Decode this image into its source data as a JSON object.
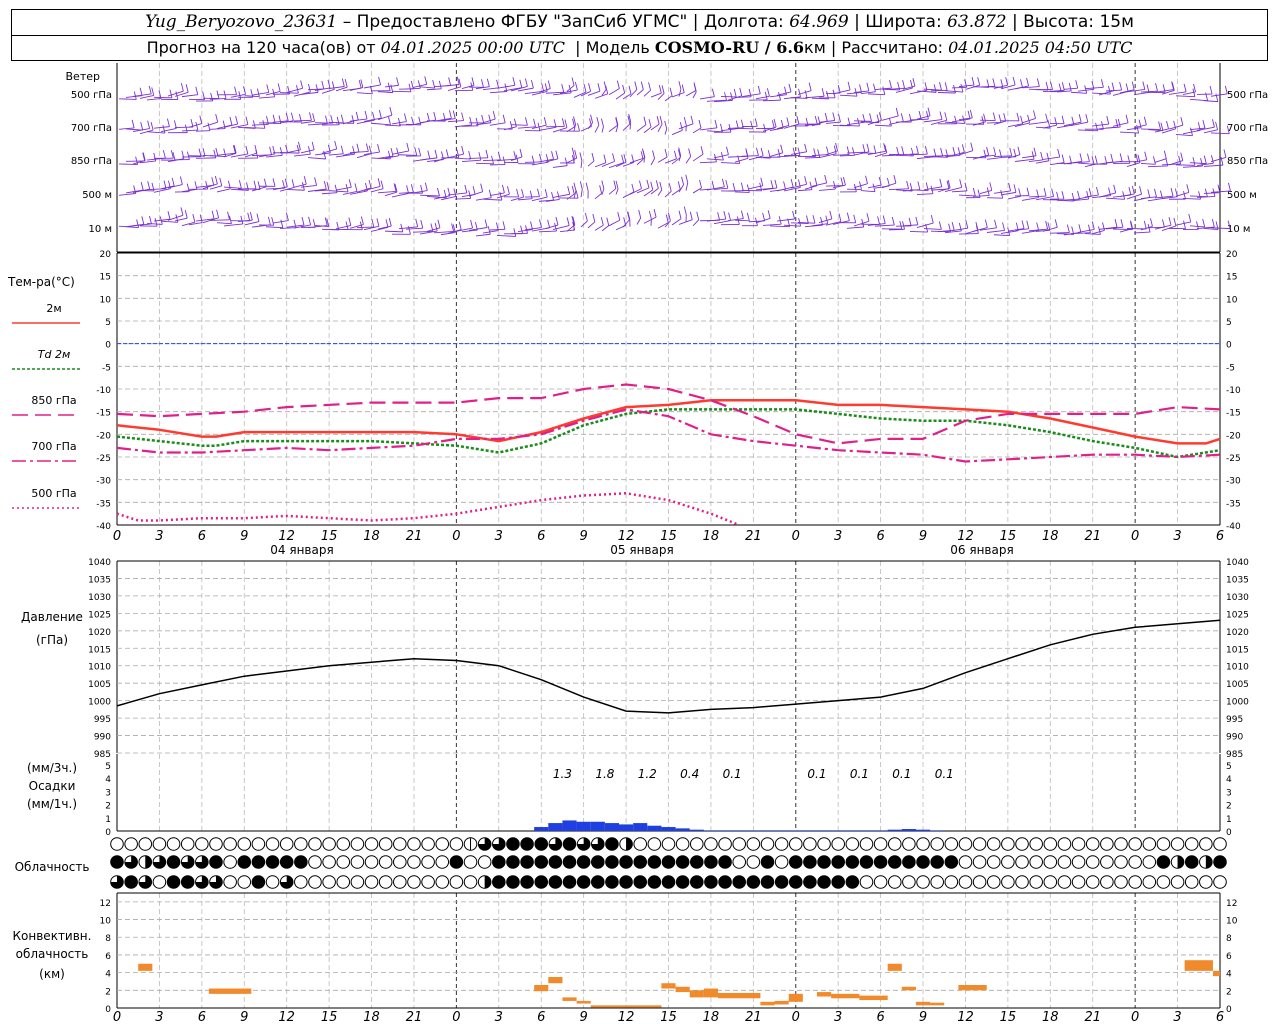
{
  "header": {
    "station": "Yug_Beryozovo_23631",
    "provided_label": "– Предоставлено ФГБУ \"ЗапСиб УГМС\"",
    "lon_label": "Долгота:",
    "lon": "64.969",
    "lat_label": "Широта:",
    "lat": "63.872",
    "alt_label": "Высота:",
    "alt": "15м",
    "forecast_label": "Прогноз на 120 часа(ов) от",
    "forecast_time": "04.01.2025 00:00 UTC",
    "model_label": "Модель",
    "model": "COSMO-RU / 6.6",
    "model_unit": "км",
    "calc_label": "Рассчитано:",
    "calc_time": "04.01.2025 04:50 UTC"
  },
  "chart_data": [
    {
      "type": "barbs",
      "ylabel": "Ветер",
      "levels": [
        "500 гПа",
        "700 гПа",
        "850 гПа",
        "500 м",
        "10 м"
      ],
      "barb_color": "#7b2fd0"
    },
    {
      "type": "line",
      "ylabel": "Тем-ра(°C)",
      "ylim": [
        -40,
        20
      ],
      "yticks": [
        -40,
        -35,
        -30,
        -25,
        -20,
        -15,
        -10,
        -5,
        0,
        5,
        10,
        15,
        20
      ],
      "x_hours": [
        0,
        3,
        6,
        9,
        12,
        15,
        18,
        21,
        24,
        27,
        30,
        33,
        36,
        39,
        42,
        45,
        48,
        51,
        54,
        57,
        60,
        63,
        66,
        69,
        72,
        75,
        78
      ],
      "xtick_labels": [
        "0",
        "3",
        "6",
        "9",
        "12",
        "15",
        "18",
        "21",
        "0",
        "3",
        "6",
        "9",
        "12",
        "15",
        "18",
        "21",
        "0",
        "3",
        "6",
        "9",
        "12",
        "15",
        "18",
        "21",
        "0",
        "3",
        "6"
      ],
      "date_labels": [
        "04 января",
        "05 января",
        "06 января"
      ],
      "zero_line": true,
      "series": [
        {
          "name": "2м",
          "color": "#ff3b30",
          "dash": "solid",
          "width": 2.5,
          "x": [
            0,
            3,
            6,
            7,
            9,
            12,
            18,
            21,
            24,
            27,
            30,
            33,
            36,
            39,
            42,
            45,
            48,
            51,
            54,
            57,
            60,
            63,
            66,
            69,
            72,
            75,
            77,
            78
          ],
          "y": [
            -18,
            -19,
            -20.5,
            -20.5,
            -19.5,
            -19.5,
            -19.5,
            -19.5,
            -20,
            -21.5,
            -19.5,
            -16.5,
            -14,
            -13.5,
            -12.5,
            -12.5,
            -12.5,
            -13.5,
            -13.5,
            -14,
            -14.5,
            -15,
            -16.5,
            -18.5,
            -20.5,
            -22,
            -22,
            -21
          ]
        },
        {
          "name": "Td 2м",
          "color": "#1a8c1a",
          "dash": "3,2",
          "width": 2.5,
          "x": [
            0,
            3,
            6,
            7,
            9,
            12,
            18,
            21,
            24,
            27,
            30,
            33,
            36,
            39,
            42,
            45,
            48,
            51,
            54,
            57,
            60,
            63,
            66,
            69,
            72,
            75,
            78
          ],
          "y": [
            -20.5,
            -21.5,
            -22.5,
            -22.5,
            -21.5,
            -21.5,
            -21.5,
            -22,
            -22.5,
            -24,
            -22,
            -18,
            -15.5,
            -14.5,
            -14.5,
            -14.5,
            -14.5,
            -15.5,
            -16.5,
            -17,
            -17,
            -18,
            -19.5,
            -21.5,
            -23,
            -25,
            -23.5
          ]
        },
        {
          "name": "850 гПа",
          "color": "#e0208a",
          "dash": "16,7",
          "width": 2.2,
          "x": [
            0,
            3,
            6,
            9,
            12,
            15,
            18,
            21,
            24,
            27,
            30,
            33,
            36,
            39,
            42,
            45,
            48,
            51,
            54,
            57,
            60,
            63,
            66,
            69,
            72,
            75,
            78
          ],
          "y": [
            -15.5,
            -16,
            -15.5,
            -15,
            -14,
            -13.5,
            -13,
            -13,
            -13,
            -12,
            -12,
            -10,
            -9,
            -10,
            -12.5,
            -16,
            -20,
            -22,
            -21,
            -21,
            -17,
            -15.5,
            -15.5,
            -15.5,
            -15.5,
            -14,
            -14.5
          ]
        },
        {
          "name": "700 гПа",
          "color": "#e0208a",
          "dash": "14,4,3,4",
          "width": 2.2,
          "x": [
            0,
            3,
            6,
            9,
            12,
            15,
            18,
            21,
            24,
            27,
            30,
            33,
            36,
            39,
            42,
            45,
            48,
            51,
            54,
            57,
            60,
            63,
            66,
            69,
            72,
            75,
            78
          ],
          "y": [
            -23,
            -24,
            -24,
            -23.5,
            -23,
            -23.5,
            -23,
            -22.5,
            -21,
            -21,
            -20,
            -17,
            -14.5,
            -16,
            -20,
            -21.5,
            -22.5,
            -23.5,
            -24,
            -24.5,
            -26,
            -25.5,
            -25,
            -24.5,
            -24.5,
            -25,
            -24.5
          ]
        },
        {
          "name": "500 гПа",
          "color": "#e0208a",
          "dash": "2,3",
          "width": 2.5,
          "x": [
            0,
            1.5,
            3,
            6,
            9,
            12,
            15,
            18,
            21,
            24,
            27,
            30,
            33,
            36,
            39,
            42,
            44
          ],
          "y": [
            -37.5,
            -39,
            -39,
            -38.5,
            -38.5,
            -38,
            -38.5,
            -39,
            -38.5,
            -37.5,
            -36,
            -34.5,
            -33.5,
            -33,
            -34.5,
            -37.5,
            -40
          ]
        }
      ]
    },
    {
      "type": "line",
      "ylabel": "Давление",
      "yunit": "(гПа)",
      "ylim": [
        985,
        1040
      ],
      "yticks": [
        985,
        990,
        995,
        1000,
        1005,
        1010,
        1015,
        1020,
        1025,
        1030,
        1035,
        1040
      ],
      "series": [
        {
          "color": "#000000",
          "x": [
            0,
            3,
            6,
            9,
            12,
            15,
            18,
            21,
            24,
            27,
            30,
            33,
            36,
            39,
            42,
            45,
            48,
            51,
            54,
            57,
            60,
            63,
            66,
            69,
            72,
            75,
            78
          ],
          "y": [
            998.5,
            1002,
            1004.5,
            1007,
            1008.5,
            1010,
            1011,
            1012,
            1011.5,
            1010,
            1006,
            1001,
            997,
            996.5,
            997.5,
            998,
            999,
            1000,
            1001,
            1003.5,
            1008,
            1012,
            1016,
            1019,
            1021,
            1022,
            1023
          ]
        }
      ]
    },
    {
      "type": "bar",
      "ylabel": "Осадки",
      "ylabels": [
        "(мм/3ч.)",
        "(мм/1ч.)"
      ],
      "ylim": [
        0,
        5
      ],
      "yticks": [
        0,
        1,
        2,
        3,
        4,
        5
      ],
      "bar_color": "#1f3fe0",
      "x": [
        30,
        31,
        32,
        33,
        34,
        35,
        36,
        37,
        38,
        39,
        40,
        41,
        42,
        43,
        44,
        45,
        46,
        47,
        48,
        49,
        50,
        51,
        52,
        53,
        54,
        55,
        56,
        57,
        58
      ],
      "values": [
        0.3,
        0.6,
        0.8,
        0.7,
        0.7,
        0.6,
        0.5,
        0.6,
        0.4,
        0.3,
        0.2,
        0.1,
        0.05,
        0.05,
        0.05,
        0.05,
        0.05,
        0.05,
        0.05,
        0.05,
        0.05,
        0.05,
        0.05,
        0.05,
        0.05,
        0.1,
        0.15,
        0.1,
        0.05
      ],
      "totals_3h": [
        {
          "hour": 31.5,
          "label": "1.3"
        },
        {
          "hour": 34.5,
          "label": "1.8"
        },
        {
          "hour": 37.5,
          "label": "1.2"
        },
        {
          "hour": 40.5,
          "label": "0.4"
        },
        {
          "hour": 43.5,
          "label": "0.1"
        },
        {
          "hour": 49.5,
          "label": "0.1"
        },
        {
          "hour": 52.5,
          "label": "0.1"
        },
        {
          "hour": 55.5,
          "label": "0.1"
        },
        {
          "hour": 58.5,
          "label": "0.1"
        }
      ]
    },
    {
      "type": "symbols",
      "ylabel": "Облачность",
      "row_states": [
        "000000000000000000000000013344434334200000000000000000000000000000000000000000",
        "432343340444440000000000400444444444444444440040444444444444000000000000004242422244",
        "343044330040300000000000002444444444444444444444444440000000000000000000000000000000"
      ]
    },
    {
      "type": "bar",
      "ylabel": "Конвективн. облачность",
      "yunit": "(км)",
      "ylim": [
        0,
        13
      ],
      "yticks": [
        0,
        2,
        4,
        6,
        8,
        10,
        12
      ],
      "bar_color": "#f08a2a",
      "segments": [
        {
          "x0": 1.5,
          "x1": 2.5,
          "bottom": 4.2,
          "top": 5.0
        },
        {
          "x0": 6.5,
          "x1": 9.5,
          "bottom": 1.6,
          "top": 2.2
        },
        {
          "x0": 29.5,
          "x1": 30.5,
          "bottom": 1.9,
          "top": 2.6
        },
        {
          "x0": 30.5,
          "x1": 31.5,
          "bottom": 2.8,
          "top": 3.5
        },
        {
          "x0": 31.5,
          "x1": 32.5,
          "bottom": 0.8,
          "top": 1.2
        },
        {
          "x0": 32.5,
          "x1": 33.5,
          "bottom": 0.5,
          "top": 0.8
        },
        {
          "x0": 33.5,
          "x1": 38.5,
          "bottom": 0.1,
          "top": 0.3
        },
        {
          "x0": 38.5,
          "x1": 39.5,
          "bottom": 2.2,
          "top": 2.8
        },
        {
          "x0": 39.5,
          "x1": 40.5,
          "bottom": 1.8,
          "top": 2.4
        },
        {
          "x0": 40.5,
          "x1": 41.5,
          "bottom": 1.2,
          "top": 2.0
        },
        {
          "x0": 41.5,
          "x1": 42.5,
          "bottom": 1.2,
          "top": 2.2
        },
        {
          "x0": 42.5,
          "x1": 45.5,
          "bottom": 1.1,
          "top": 1.7
        },
        {
          "x0": 45.5,
          "x1": 46.5,
          "bottom": 0.3,
          "top": 0.7
        },
        {
          "x0": 46.5,
          "x1": 47.5,
          "bottom": 0.4,
          "top": 0.8
        },
        {
          "x0": 47.5,
          "x1": 48.5,
          "bottom": 0.7,
          "top": 1.6
        },
        {
          "x0": 49.5,
          "x1": 50.5,
          "bottom": 1.3,
          "top": 1.8
        },
        {
          "x0": 50.5,
          "x1": 52.5,
          "bottom": 1.1,
          "top": 1.6
        },
        {
          "x0": 52.5,
          "x1": 54.5,
          "bottom": 0.9,
          "top": 1.4
        },
        {
          "x0": 54.5,
          "x1": 55.5,
          "bottom": 4.2,
          "top": 5.0
        },
        {
          "x0": 55.5,
          "x1": 56.5,
          "bottom": 2.0,
          "top": 2.4
        },
        {
          "x0": 56.5,
          "x1": 57.5,
          "bottom": 0.3,
          "top": 0.7
        },
        {
          "x0": 57.5,
          "x1": 58.5,
          "bottom": 0.3,
          "top": 0.6
        },
        {
          "x0": 59.5,
          "x1": 61.5,
          "bottom": 2.0,
          "top": 2.6
        },
        {
          "x0": 75.5,
          "x1": 77.5,
          "bottom": 4.2,
          "top": 5.4
        },
        {
          "x0": 77.5,
          "x1": 78.0,
          "bottom": 3.6,
          "top": 4.2
        }
      ]
    }
  ]
}
